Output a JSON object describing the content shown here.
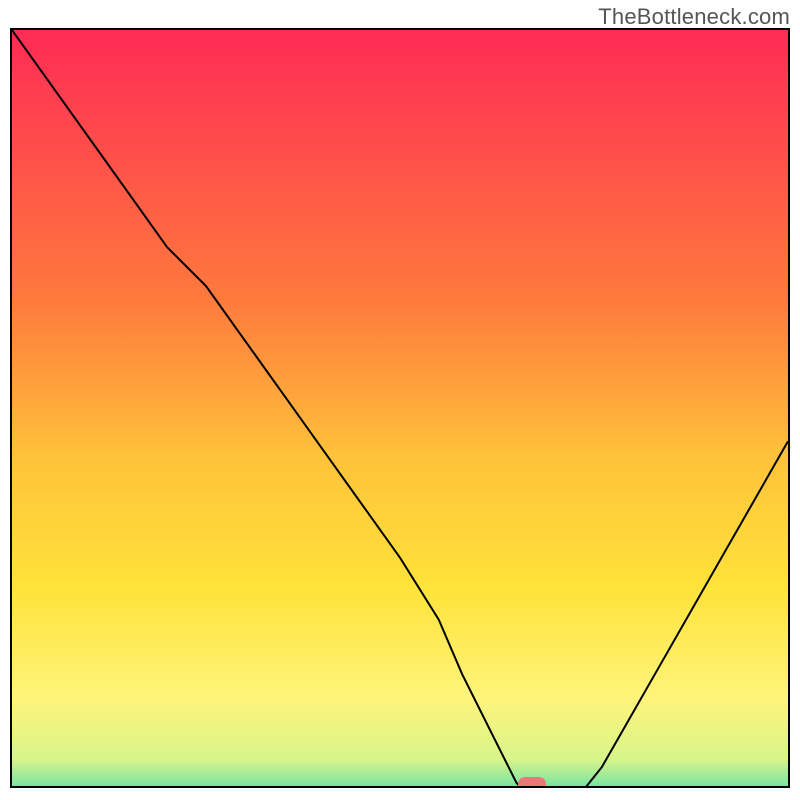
{
  "watermark": "TheBottleneck.com",
  "chart_data": {
    "type": "line",
    "title": "",
    "xlabel": "",
    "ylabel": "",
    "xlim": [
      0,
      100
    ],
    "ylim": [
      0,
      100
    ],
    "x": [
      0,
      5,
      10,
      15,
      20,
      25,
      30,
      35,
      40,
      45,
      50,
      55,
      58,
      62,
      65,
      68,
      72,
      76,
      80,
      84,
      88,
      92,
      96,
      100
    ],
    "values": [
      100,
      93,
      86,
      79,
      72,
      67,
      60,
      53,
      46,
      39,
      32,
      24,
      17,
      9,
      3,
      0,
      0,
      5,
      12,
      19,
      26,
      33,
      40,
      47
    ],
    "marker": {
      "x": 67,
      "y": 0
    },
    "gradient_stops": [
      {
        "pos": 0,
        "color": "#ff2b55"
      },
      {
        "pos": 35,
        "color": "#ff7a3d"
      },
      {
        "pos": 55,
        "color": "#ffc23a"
      },
      {
        "pos": 72,
        "color": "#ffe33a"
      },
      {
        "pos": 86,
        "color": "#fff47a"
      },
      {
        "pos": 94,
        "color": "#d8f58a"
      },
      {
        "pos": 97,
        "color": "#86e6a0"
      },
      {
        "pos": 100,
        "color": "#1fd36e"
      }
    ]
  }
}
